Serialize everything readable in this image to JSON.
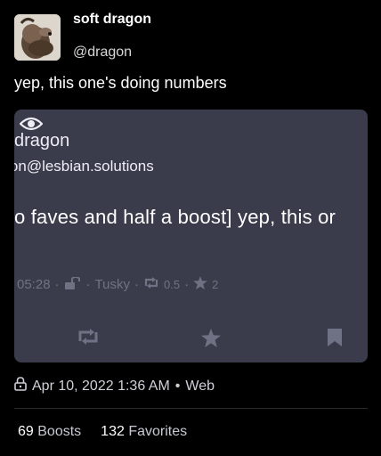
{
  "author": {
    "display_name": "soft dragon",
    "handle": "@dragon"
  },
  "post": {
    "text": "yep, this one's doing numbers"
  },
  "quoted": {
    "display_name": "dragon",
    "handle": "agon@lesbian.solutions",
    "content": "o faves and half a boost] yep, this or",
    "time": "05:28",
    "client": "Tusky",
    "boosts": "0.5",
    "favorites": "2"
  },
  "meta": {
    "date": "Apr 10, 2022 1:36 AM",
    "bullet": "•",
    "source": "Web"
  },
  "stats": {
    "boosts_count": "69",
    "boosts_label": "Boosts",
    "favorites_count": "132",
    "favorites_label": "Favorites"
  },
  "colors": {
    "background": "#000000",
    "embed_bg": "#3a3c4b",
    "muted": "#6f7285",
    "icon": "#6f7285"
  },
  "icons": {
    "visibility": "eye-icon",
    "lock": "unlocked-lock-icon",
    "boost": "boost-icon",
    "favorite": "star-icon",
    "bookmark": "bookmark-icon",
    "timestamp_lock": "lock-icon"
  }
}
